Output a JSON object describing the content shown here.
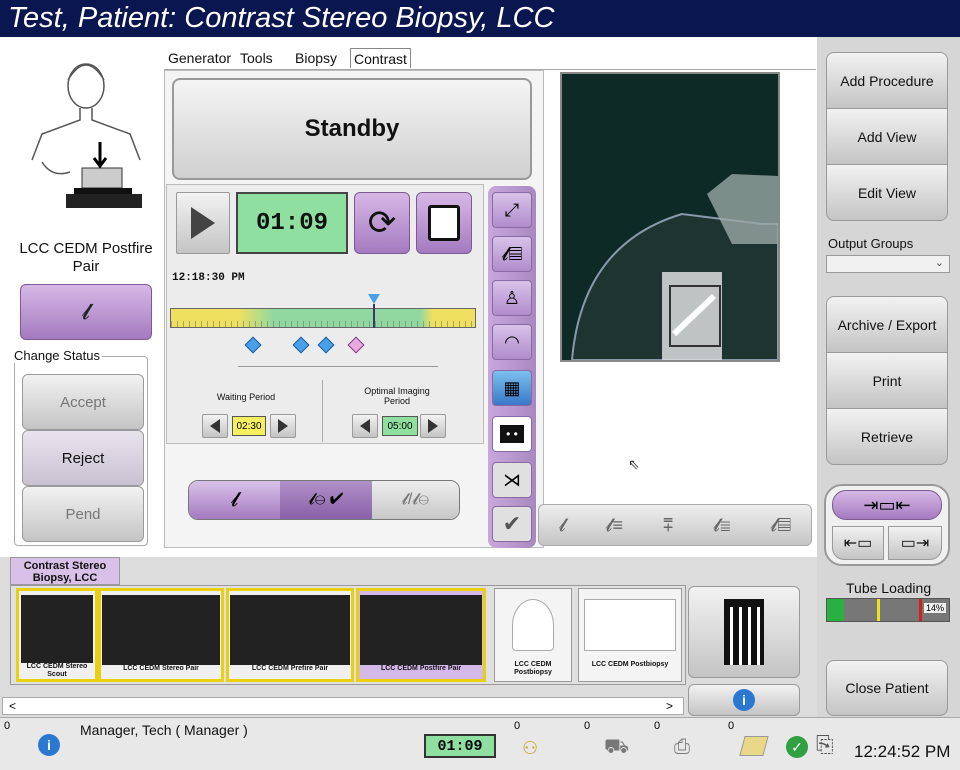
{
  "title": "Test, Patient:  Contrast Stereo Biopsy, LCC",
  "tabs": [
    {
      "label": "Generator"
    },
    {
      "label": "Tools"
    },
    {
      "label": "Biopsy"
    },
    {
      "label": "Contrast"
    }
  ],
  "left": {
    "view_label": "LCC CEDM Postfire Pair",
    "change_status_label": "Change Status",
    "accept_label": "Accept",
    "reject_label": "Reject",
    "pend_label": "Pend"
  },
  "center": {
    "standby_label": "Standby",
    "timer_display": "01:09",
    "start_time": "12:18:30 PM",
    "waiting_period_label": "Waiting Period",
    "waiting_period_value": "02:30",
    "optimal_period_label": "Optimal Imaging Period",
    "optimal_period_value": "05:00"
  },
  "procedure_tab": "Contrast Stereo Biopsy, LCC",
  "thumbnails": [
    {
      "label": "LCC CEDM Stereo Scout"
    },
    {
      "label": "LCC CEDM Stereo Pair"
    },
    {
      "label": "LCC CEDM Prefire Pair"
    },
    {
      "label": "LCC CEDM Postfire Pair"
    },
    {
      "label": "LCC CEDM Postbiopsy"
    },
    {
      "label": "LCC CEDM Postbiopsy"
    }
  ],
  "right": {
    "add_procedure": "Add Procedure",
    "add_view": "Add View",
    "edit_view": "Edit View",
    "output_groups_label": "Output Groups",
    "output_groups_value": "",
    "archive_export": "Archive / Export",
    "print": "Print",
    "retrieve": "Retrieve",
    "tube_loading_label": "Tube Loading",
    "tube_loading_percent": "14%",
    "tube_loading_fraction": 0.14,
    "close_patient": "Close Patient"
  },
  "status": {
    "count_info": "0",
    "user": "Manager, Tech ( Manager )",
    "timer": "01:09",
    "count_timer": "0",
    "count_help": "0",
    "count_device": "0",
    "count_printer": "0",
    "clock": "12:24:52 PM"
  },
  "colors": {
    "title_bg": "#0a1650",
    "accent_purple": "#a57ac0",
    "timer_green": "#8fe0a0",
    "highlight_yellow": "#f0e020"
  }
}
